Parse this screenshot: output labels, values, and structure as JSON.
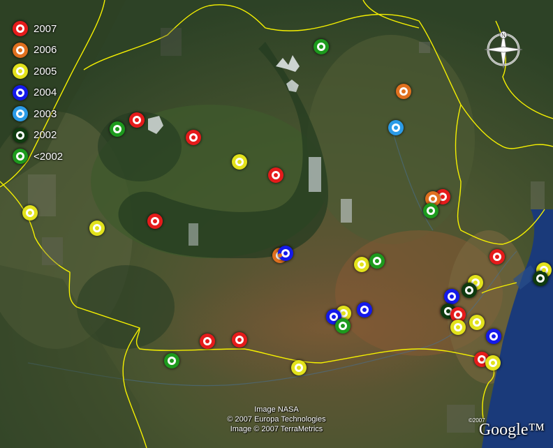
{
  "legend": [
    {
      "label": "2007",
      "color": "#e51b1b"
    },
    {
      "label": "2006",
      "color": "#e0701f"
    },
    {
      "label": "2005",
      "color": "#e2e21c"
    },
    {
      "label": "2004",
      "color": "#1419ea"
    },
    {
      "label": "2003",
      "color": "#2b9be8"
    },
    {
      "label": "2002",
      "color": "#0f3a0f"
    },
    {
      "label": "<2002",
      "color": "#1d9a1d"
    }
  ],
  "credits": {
    "line1": "Image NASA",
    "line2": "© 2007 Europa Technologies",
    "line3": "Image © 2007 TerraMetrics"
  },
  "logo": {
    "small": "©2007",
    "text": "Google™"
  },
  "compass": {
    "north_label": "N",
    "icon": "compass-icon"
  },
  "colors": {
    "border": "#f5f000",
    "water": "#1a3a7a"
  }
}
